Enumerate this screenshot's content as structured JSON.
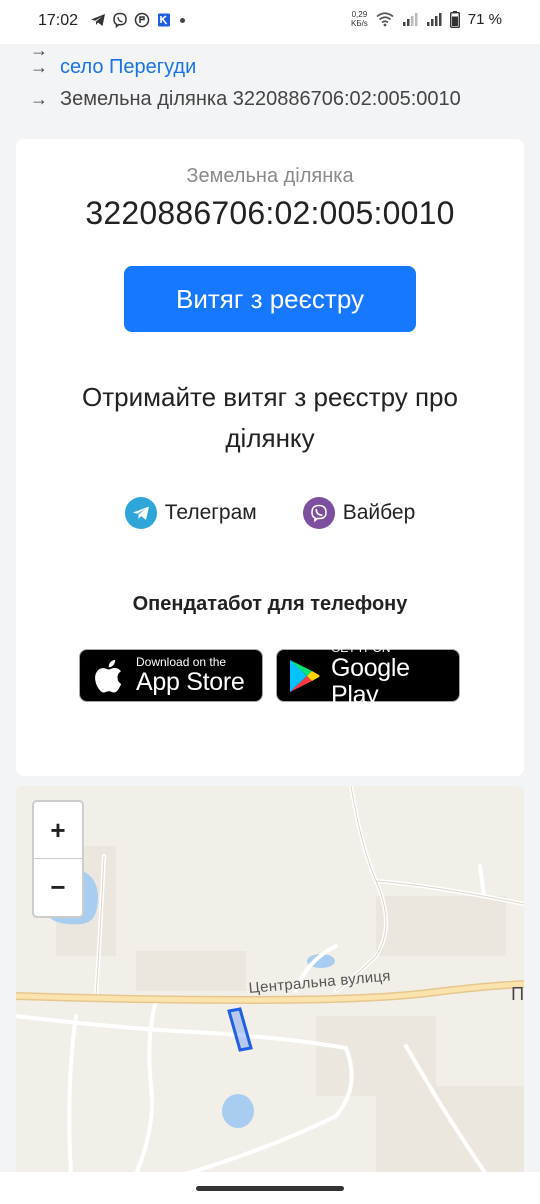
{
  "status_bar": {
    "time": "17:02",
    "net_speed_value": "0,29",
    "net_speed_unit": "KБ/s",
    "battery": "71 %",
    "icons": [
      "telegram-icon",
      "viber-icon",
      "gmail-icon",
      "shield-icon",
      "wifi-icon",
      "signal-icon",
      "battery-icon"
    ]
  },
  "breadcrumb": {
    "items": [
      {
        "label": "село Перегуди",
        "kind": "link"
      },
      {
        "label": "Земельна ділянка 3220886706:02:005:0010",
        "kind": "text"
      }
    ]
  },
  "card": {
    "subtitle": "Земельна ділянка",
    "title": "3220886706:02:005:0010",
    "extract_button": "Витяг з реєстру",
    "promo_text": "Отримайте витяг з реєстру про ділянку",
    "messengers": [
      {
        "label": "Телеграм",
        "icon": "telegram-icon",
        "color": "#2ea6da"
      },
      {
        "label": "Вайбер",
        "icon": "viber-icon",
        "color": "#7d509f"
      }
    ],
    "apps_title": "Опендатабот для телефону",
    "app_store": {
      "small": "Download on the",
      "big": "App Store"
    },
    "google_play": {
      "small": "GET IT ON",
      "big": "Google Play"
    }
  },
  "map": {
    "zoom_in": "+",
    "zoom_out": "−",
    "street_label": "Центральна вулиця",
    "edge_label": "П",
    "parcel_color": "#1f5fe6"
  },
  "colors": {
    "accent": "#1677ff",
    "link": "#1a73e8",
    "background": "#f3f4f6"
  }
}
